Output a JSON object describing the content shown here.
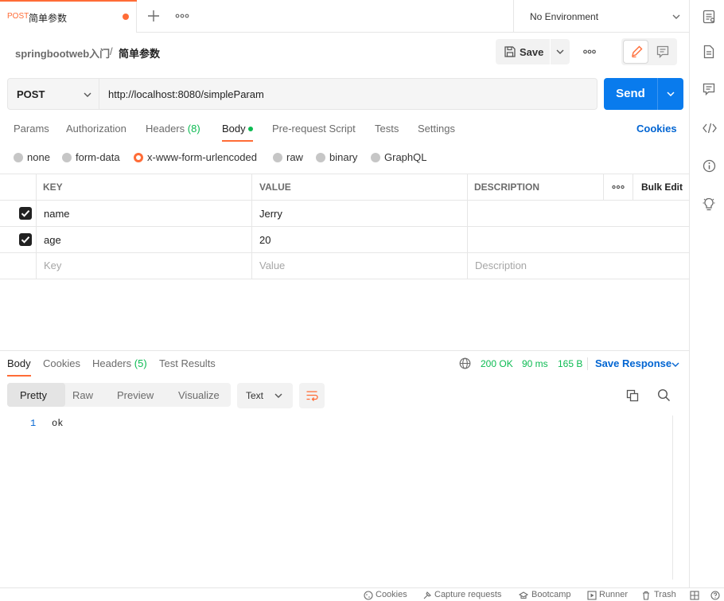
{
  "tab": {
    "method": "POST",
    "name": "简单参数"
  },
  "environment": {
    "label": "No Environment"
  },
  "breadcrumb": {
    "collection": "springbootweb入门",
    "separator": "/",
    "request": "简单参数"
  },
  "toolbar": {
    "save_label": "Save"
  },
  "request": {
    "method": "POST",
    "url": "http://localhost:8080/simpleParam",
    "send_label": "Send",
    "tabs": {
      "params": "Params",
      "authorization": "Authorization",
      "headers": "Headers",
      "headers_count": "(8)",
      "body": "Body",
      "prerequest": "Pre-request Script",
      "tests": "Tests",
      "settings": "Settings"
    },
    "cookies_label": "Cookies",
    "body_types": [
      "none",
      "form-data",
      "x-www-form-urlencoded",
      "raw",
      "binary",
      "GraphQL"
    ],
    "body_type_selected": "x-www-form-urlencoded"
  },
  "params_table": {
    "headers": {
      "key": "KEY",
      "value": "VALUE",
      "description": "DESCRIPTION",
      "bulk_edit": "Bulk Edit"
    },
    "rows": [
      {
        "key": "name",
        "value": "Jerry",
        "description": ""
      },
      {
        "key": "age",
        "value": "20",
        "description": ""
      }
    ],
    "placeholders": {
      "key": "Key",
      "value": "Value",
      "description": "Description"
    }
  },
  "response": {
    "tabs": {
      "body": "Body",
      "cookies": "Cookies",
      "headers": "Headers",
      "headers_count": "(5)",
      "test_results": "Test Results"
    },
    "status": "200 OK",
    "time": "90 ms",
    "size": "165 B",
    "save_label": "Save Response",
    "views": [
      "Pretty",
      "Raw",
      "Preview",
      "Visualize"
    ],
    "format": "Text",
    "lines": [
      {
        "num": "1",
        "text": "ok"
      }
    ]
  },
  "statusbar": {
    "cookies": "Cookies",
    "capture": "Capture requests",
    "bootcamp": "Bootcamp",
    "runner": "Runner",
    "trash": "Trash"
  },
  "colors": {
    "accent": "#ff6c37",
    "primary": "#097bed",
    "success": "#0cbb52",
    "link": "#0265d2"
  }
}
